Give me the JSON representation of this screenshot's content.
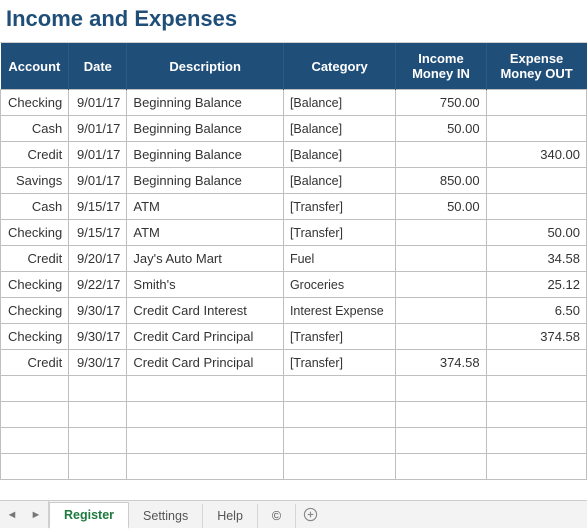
{
  "title": "Income and Expenses",
  "columns": {
    "account": "Account",
    "date": "Date",
    "description": "Description",
    "category": "Category",
    "income": "Income Money IN",
    "expense": "Expense Money OUT"
  },
  "rows": [
    {
      "account": "Checking",
      "date": "9/01/17",
      "description": "Beginning Balance",
      "category": "[Balance]",
      "income": "750.00",
      "expense": ""
    },
    {
      "account": "Cash",
      "date": "9/01/17",
      "description": "Beginning Balance",
      "category": "[Balance]",
      "income": "50.00",
      "expense": ""
    },
    {
      "account": "Credit",
      "date": "9/01/17",
      "description": "Beginning Balance",
      "category": "[Balance]",
      "income": "",
      "expense": "340.00"
    },
    {
      "account": "Savings",
      "date": "9/01/17",
      "description": "Beginning Balance",
      "category": "[Balance]",
      "income": "850.00",
      "expense": ""
    },
    {
      "account": "Cash",
      "date": "9/15/17",
      "description": "ATM",
      "category": "[Transfer]",
      "income": "50.00",
      "expense": ""
    },
    {
      "account": "Checking",
      "date": "9/15/17",
      "description": "ATM",
      "category": "[Transfer]",
      "income": "",
      "expense": "50.00"
    },
    {
      "account": "Credit",
      "date": "9/20/17",
      "description": "Jay's Auto Mart",
      "category": "Fuel",
      "income": "",
      "expense": "34.58"
    },
    {
      "account": "Checking",
      "date": "9/22/17",
      "description": "Smith's",
      "category": "Groceries",
      "income": "",
      "expense": "25.12"
    },
    {
      "account": "Checking",
      "date": "9/30/17",
      "description": "Credit Card Interest",
      "category": "Interest Expense",
      "income": "",
      "expense": "6.50"
    },
    {
      "account": "Checking",
      "date": "9/30/17",
      "description": "Credit Card Principal",
      "category": "[Transfer]",
      "income": "",
      "expense": "374.58"
    },
    {
      "account": "Credit",
      "date": "9/30/17",
      "description": "Credit Card Principal",
      "category": "[Transfer]",
      "income": "374.58",
      "expense": ""
    },
    {
      "account": "",
      "date": "",
      "description": "",
      "category": "",
      "income": "",
      "expense": ""
    },
    {
      "account": "",
      "date": "",
      "description": "",
      "category": "",
      "income": "",
      "expense": ""
    },
    {
      "account": "",
      "date": "",
      "description": "",
      "category": "",
      "income": "",
      "expense": ""
    },
    {
      "account": "",
      "date": "",
      "description": "",
      "category": "",
      "income": "",
      "expense": ""
    }
  ],
  "tabs": {
    "register": "Register",
    "settings": "Settings",
    "help": "Help",
    "copyright": "©"
  },
  "nav": {
    "prev": "◄",
    "next": "►"
  }
}
